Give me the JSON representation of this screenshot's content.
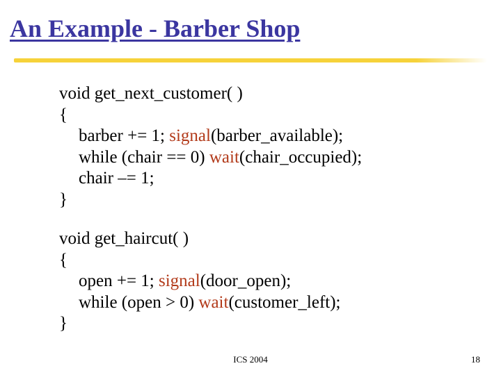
{
  "title": "An Example - Barber Shop",
  "code": {
    "fn1_sig": "void get_next_customer( )",
    "open_brace": "{",
    "fn1_l1_a": "barber += 1; ",
    "fn1_l1_kw": "signal",
    "fn1_l1_b": "(barber_available);",
    "fn1_l2_a": "while (chair == 0) ",
    "fn1_l2_kw": "wait",
    "fn1_l2_b": "(chair_occupied);",
    "fn1_l3": "chair –= 1;",
    "close_brace": "}",
    "fn2_sig": "void get_haircut( )",
    "fn2_l1_a": "open += 1; ",
    "fn2_l1_kw": "signal",
    "fn2_l1_b": "(door_open);",
    "fn2_l2_a": "while (open > 0) ",
    "fn2_l2_kw": "wait",
    "fn2_l2_b": "(customer_left);"
  },
  "footer": {
    "center": "ICS 2004",
    "page": "18"
  }
}
